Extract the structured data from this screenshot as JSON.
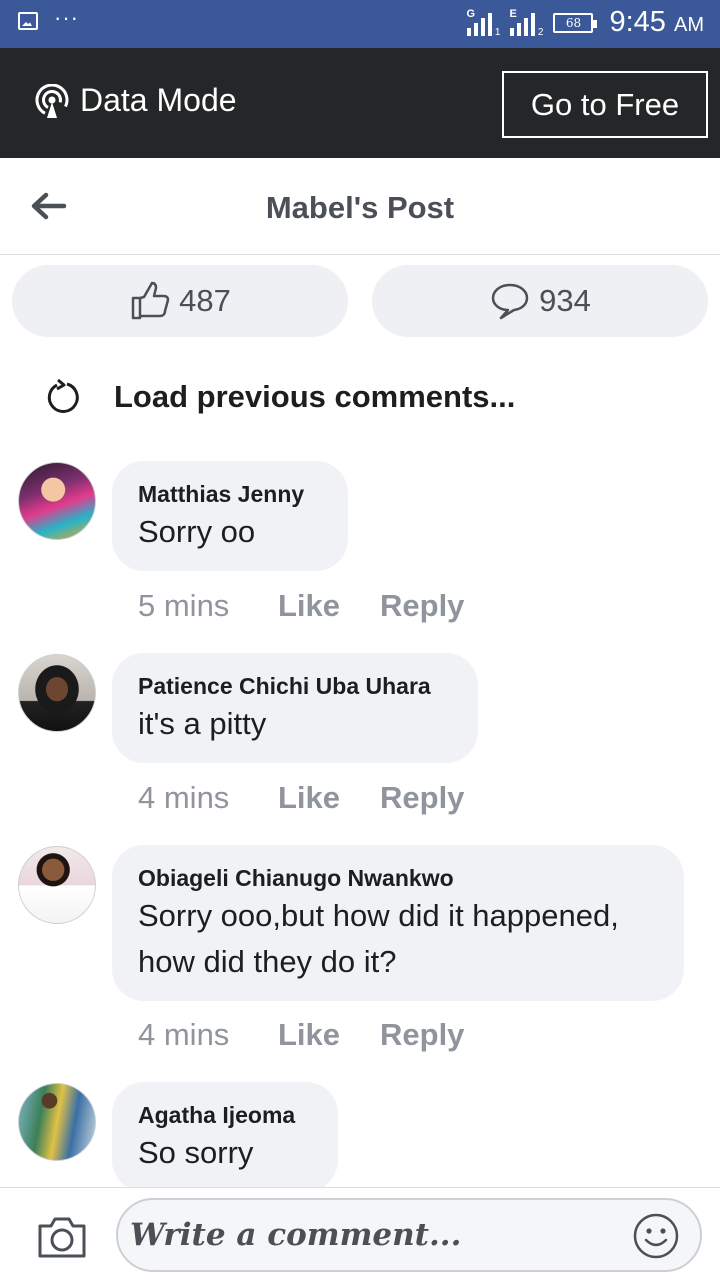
{
  "status_bar": {
    "time": "9:45",
    "ampm": "AM",
    "battery": "68",
    "sim1_network": "G",
    "sim1_slot": "1",
    "sim2_network": "E",
    "sim2_slot": "2",
    "notification_icons": [
      "image-icon",
      "more-dots-icon"
    ]
  },
  "data_mode": {
    "label": "Data Mode",
    "button": "Go to Free"
  },
  "header": {
    "title": "Mabel's Post"
  },
  "reactions": {
    "likes": "487",
    "comments": "934"
  },
  "load_previous": "Load previous comments...",
  "comments": [
    {
      "author": "Matthias Jenny",
      "text": "Sorry oo",
      "time": "5 mins",
      "like": "Like",
      "reply": "Reply"
    },
    {
      "author": "Patience Chichi Uba Uhara",
      "text": "it's a pitty",
      "time": "4 mins",
      "like": "Like",
      "reply": "Reply"
    },
    {
      "author": "Obiageli Chianugo Nwankwo",
      "text": "Sorry ooo,but how did it happened, how did they do it?",
      "time": "4 mins",
      "like": "Like",
      "reply": "Reply"
    },
    {
      "author": "Agatha Ijeoma",
      "text": "So sorry"
    }
  ],
  "composer": {
    "placeholder": "Write a comment..."
  },
  "colors": {
    "status_bar": "#3b5998",
    "data_bar": "#242628",
    "bubble": "#f0f2f5",
    "meta_text": "#90949c"
  }
}
